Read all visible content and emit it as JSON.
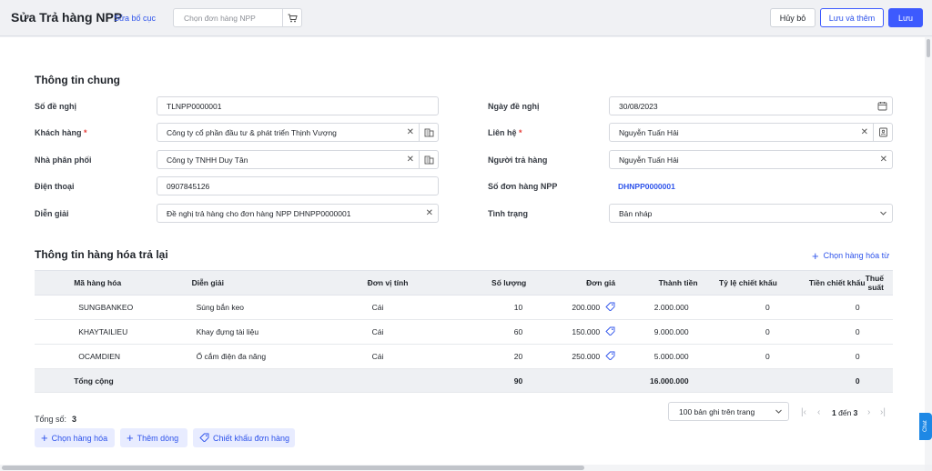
{
  "header": {
    "title": "Sửa Trả hàng NPP",
    "edit_layout": "Sửa bố cục",
    "order_placeholder": "Chọn đơn hàng NPP",
    "cancel_label": "Hủy bỏ",
    "save_add_label": "Lưu và thêm",
    "save_label": "Lưu"
  },
  "general": {
    "title": "Thông tin chung",
    "fields": {
      "request_no": {
        "label": "Số đề nghị",
        "value": "TLNPP0000001"
      },
      "customer": {
        "label": "Khách hàng",
        "value": "Công ty cổ phần đầu tư & phát triển Thịnh Vượng"
      },
      "distributor": {
        "label": "Nhà phân phối",
        "value": "Công ty TNHH Duy Tân"
      },
      "phone": {
        "label": "Điện thoại",
        "value": "0907845126"
      },
      "description": {
        "label": "Diễn giải",
        "value": "Đề nghị trả hàng cho đơn hàng NPP DHNPP0000001"
      },
      "request_date": {
        "label": "Ngày đề nghị",
        "value": "30/08/2023"
      },
      "contact": {
        "label": "Liên hệ",
        "value": "Nguyễn Tuấn Hải"
      },
      "returner": {
        "label": "Người trả hàng",
        "value": "Nguyễn Tuấn Hải"
      },
      "order_no": {
        "label": "Số đơn hàng NPP",
        "value": "DHNPP0000001"
      },
      "status": {
        "label": "Tình trạng",
        "value": "Bản nháp"
      }
    },
    "required_mark": "*"
  },
  "goods": {
    "title": "Thông tin hàng hóa trả lại",
    "pick_from_label": "Chọn hàng hóa từ",
    "columns": [
      "Mã hàng hóa",
      "Diễn giải",
      "Đơn vị tính",
      "Số lượng",
      "Đơn giá",
      "Thành tiền",
      "Tỷ lệ chiết khấu",
      "Tiền chiết khấu",
      "Thuế suất"
    ],
    "rows": [
      [
        "SUNGBANKEO",
        "Súng bắn keo",
        "Cái",
        "10",
        "200.000",
        "2.000.000",
        "0",
        "0",
        ""
      ],
      [
        "KHAYTAILIEU",
        "Khay đựng tài liệu",
        "Cái",
        "60",
        "150.000",
        "9.000.000",
        "0",
        "0",
        ""
      ],
      [
        "OCAMDIEN",
        "Ổ cắm điện đa năng",
        "Cái",
        "20",
        "250.000",
        "5.000.000",
        "0",
        "0",
        ""
      ]
    ],
    "total": {
      "label": "Tổng cộng",
      "quantity": "90",
      "amount": "16.000.000",
      "discount": "0"
    }
  },
  "footer": {
    "count_label": "Tổng số:",
    "count_value": "3",
    "page_size": "100 bản ghi trên trang",
    "page_from": "1",
    "page_sep": "đến",
    "page_to": "3",
    "pick_goods_label": "Chọn hàng hóa",
    "add_row_label": "Thêm dòng",
    "order_discount_label": "Chiết khấu đơn hàng",
    "chat_label": "Chat"
  },
  "colors": {
    "primary": "#3d5afe",
    "link": "#2f54eb",
    "required": "#e53935"
  }
}
